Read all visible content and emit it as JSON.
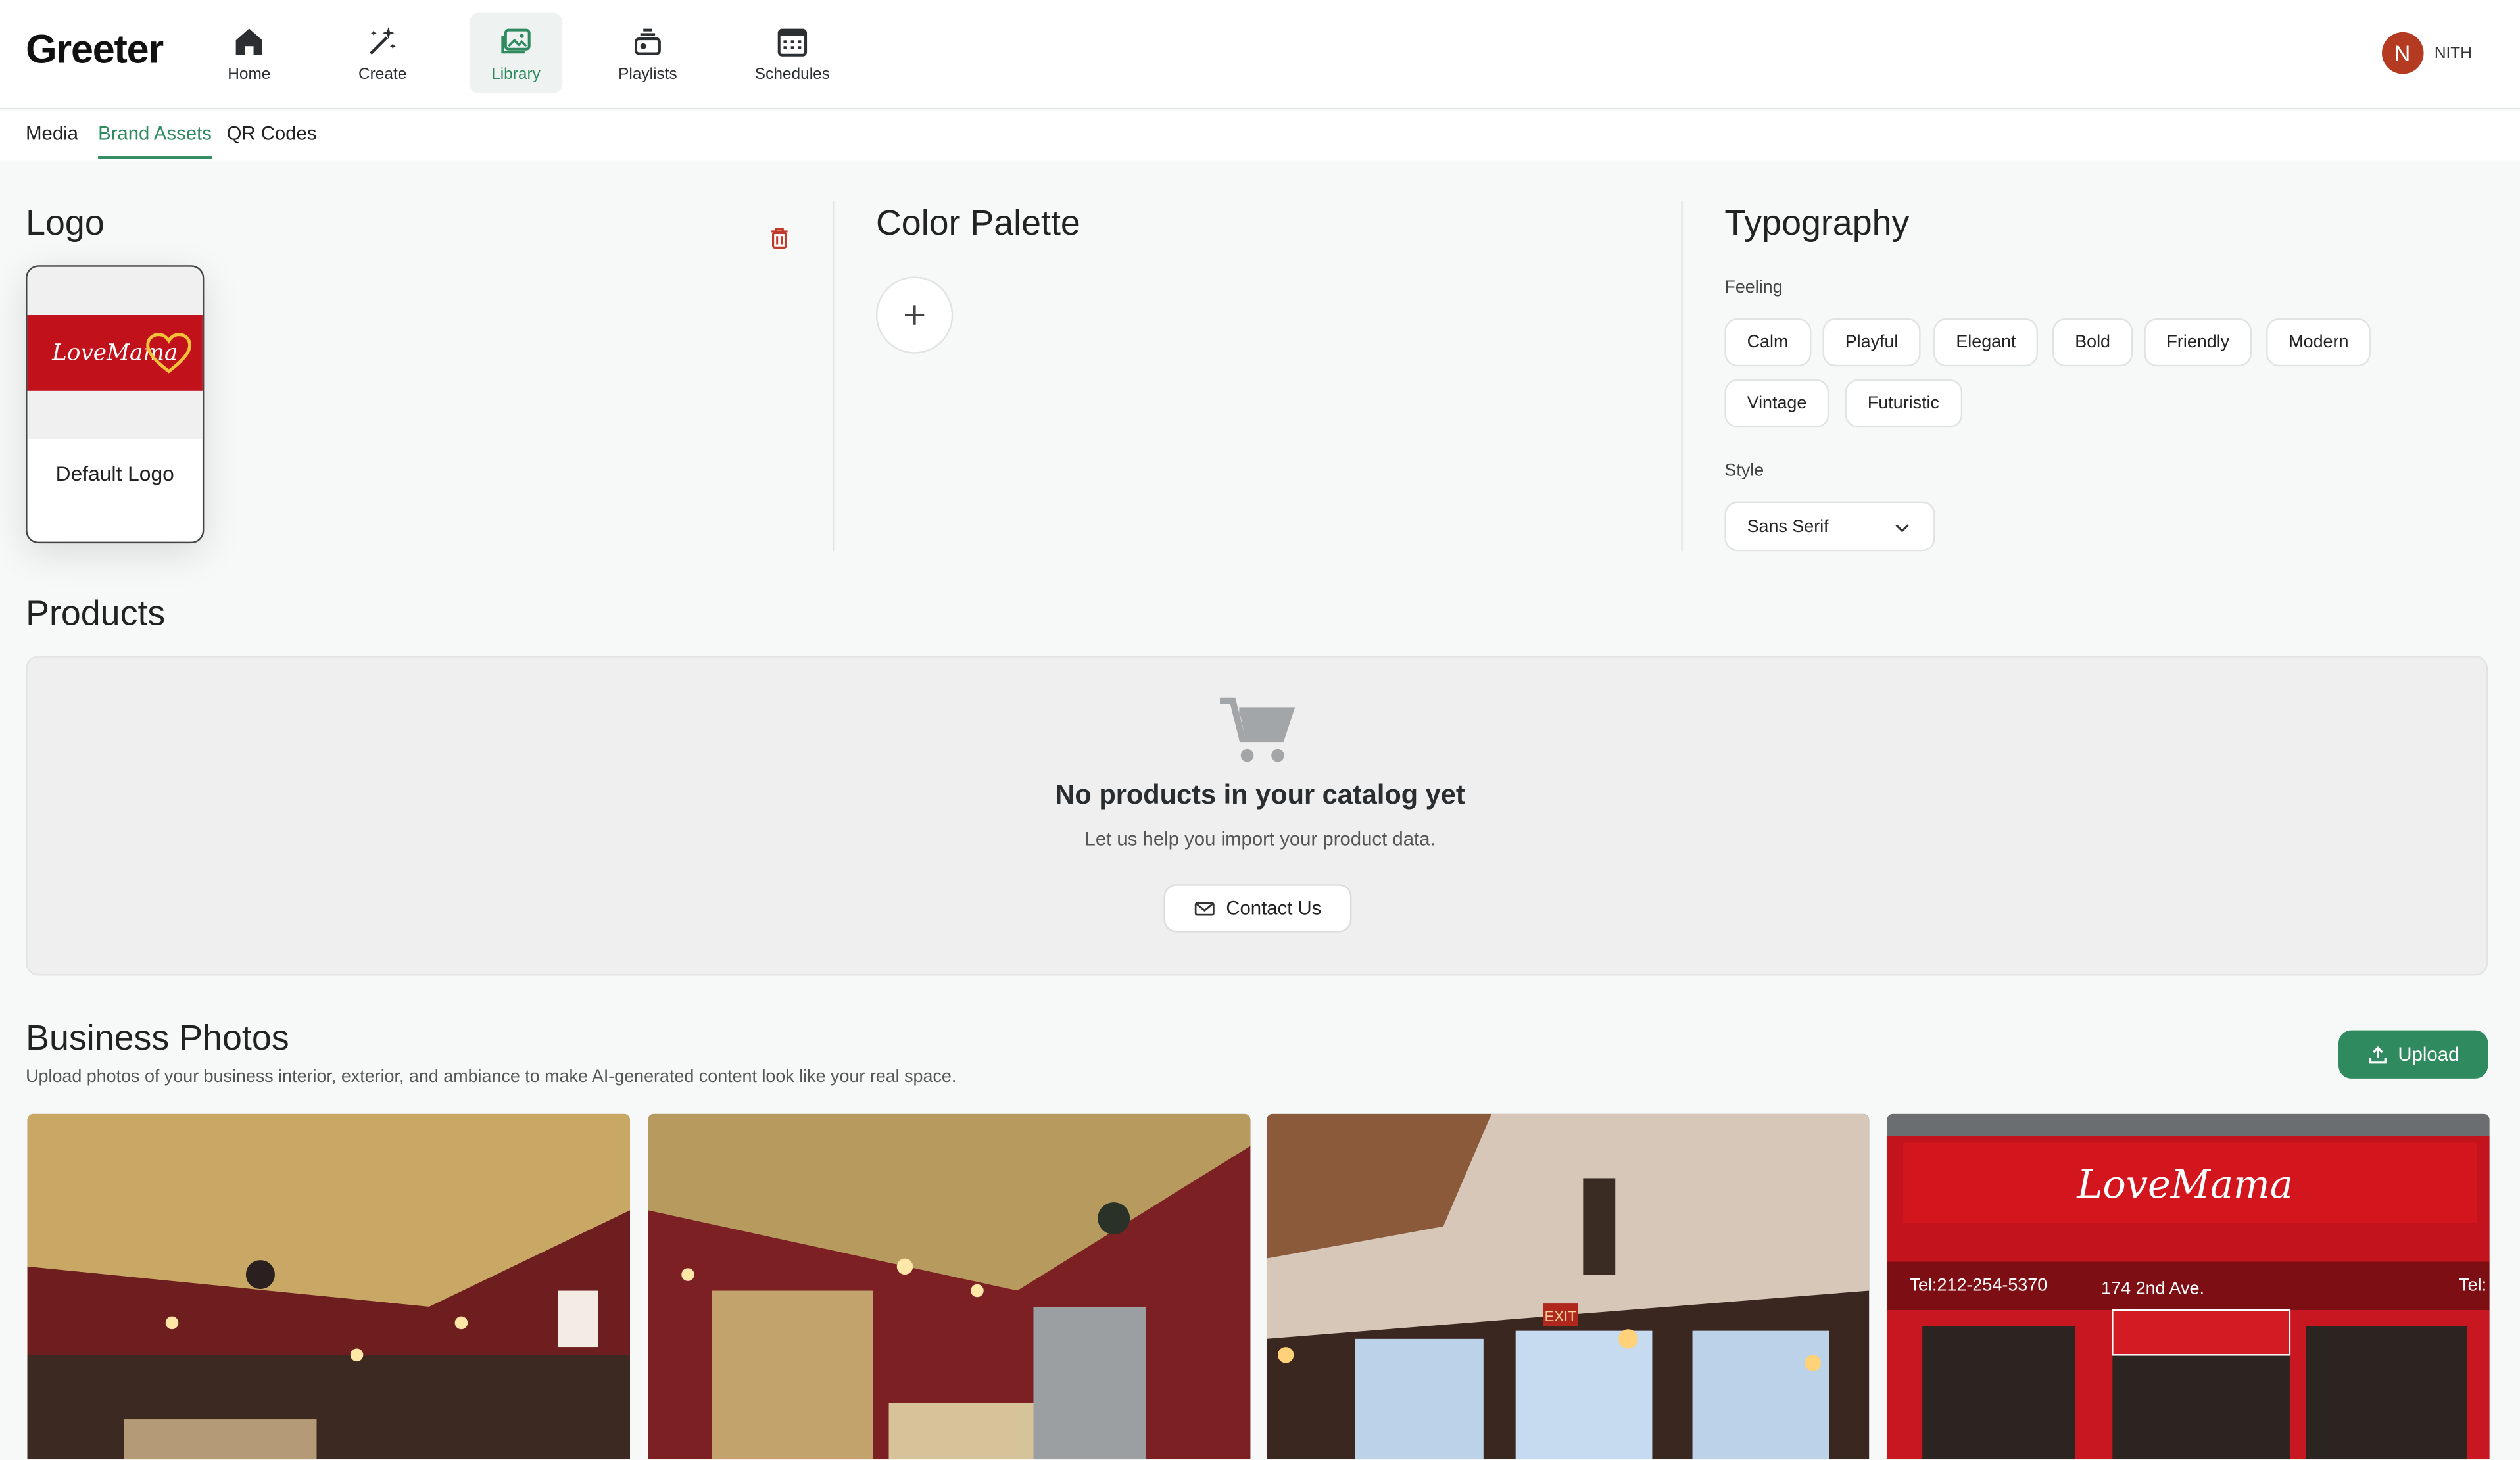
{
  "app": {
    "brand": "Greeter"
  },
  "nav": {
    "items": [
      {
        "label": "Home",
        "icon": "home-icon"
      },
      {
        "label": "Create",
        "icon": "magic-wand-icon"
      },
      {
        "label": "Library",
        "icon": "library-icon",
        "active": true
      },
      {
        "label": "Playlists",
        "icon": "playlists-icon"
      },
      {
        "label": "Schedules",
        "icon": "calendar-icon"
      }
    ]
  },
  "user": {
    "initial": "N",
    "name": "NITH",
    "avatar_color": "#b43a22"
  },
  "subtabs": [
    {
      "label": "Media"
    },
    {
      "label": "Brand Assets",
      "active": true
    },
    {
      "label": "QR Codes"
    }
  ],
  "logo": {
    "title": "Logo",
    "card_caption": "Default Logo",
    "logo_text": "LoveMama"
  },
  "color_palette": {
    "title": "Color Palette"
  },
  "typography": {
    "title": "Typography",
    "feeling_label": "Feeling",
    "feelings": [
      "Calm",
      "Playful",
      "Elegant",
      "Bold",
      "Friendly",
      "Modern",
      "Vintage",
      "Futuristic"
    ],
    "style_label": "Style",
    "style_value": "Sans Serif"
  },
  "products": {
    "title": "Products",
    "empty_title": "No products in your catalog yet",
    "empty_subtitle": "Let us help you import your product data.",
    "contact_label": "Contact Us"
  },
  "business_photos": {
    "title": "Business Photos",
    "subtitle": "Upload photos of your business interior, exterior, and ambiance to make AI-generated content look like your real space.",
    "upload_label": "Upload",
    "storefront": {
      "sign": "LoveMama",
      "tel": "Tel:212-254-5370",
      "address": "174 2nd Ave.",
      "tel_right": "Tel:",
      "exit": "EXIT"
    }
  },
  "colors": {
    "accent": "#2f8a5f",
    "brand_red": "#c1121c"
  }
}
